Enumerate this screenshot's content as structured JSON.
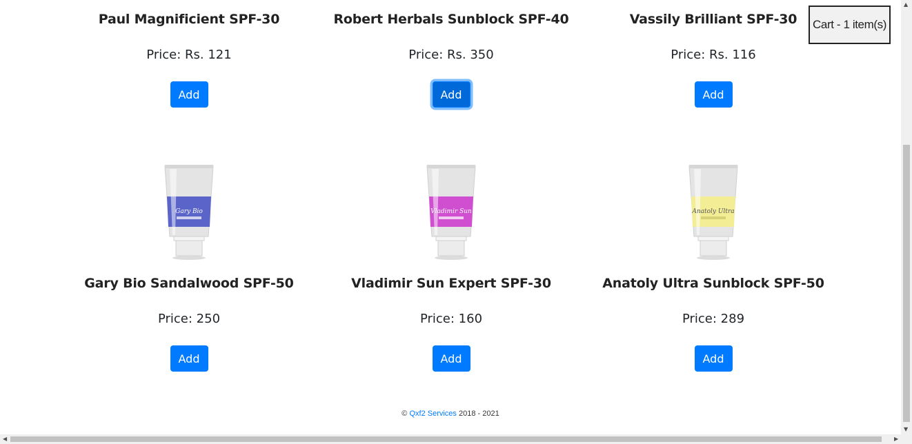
{
  "cart": {
    "label": "Cart - 1 item(s)"
  },
  "products_top": [
    {
      "name": "Paul Magnificient SPF-30",
      "price": "Price: Rs. 121",
      "button": "Add",
      "label_color": "#cfcfcf",
      "label_text": ""
    },
    {
      "name": "Robert Herbals Sunblock SPF-40",
      "price": "Price: Rs. 350",
      "button": "Add",
      "label_color": "#cfcfcf",
      "label_text": ""
    },
    {
      "name": "Vassily Brilliant SPF-30",
      "price": "Price: Rs. 116",
      "button": "Add",
      "label_color": "#cfcfcf",
      "label_text": ""
    }
  ],
  "products_bottom": [
    {
      "name": "Gary Bio Sandalwood SPF-50",
      "price": "Price: 250",
      "button": "Add",
      "label_color": "#5b64c9",
      "label_text": "Gary Bio"
    },
    {
      "name": "Vladimir Sun Expert SPF-30",
      "price": "Price: 160",
      "button": "Add",
      "label_color": "#cf4fd0",
      "label_text": "Vladimir Sun"
    },
    {
      "name": "Anatoly Ultra Sunblock SPF-50",
      "price": "Price: 289",
      "button": "Add",
      "label_color": "#f3ee96",
      "label_text": "Anatoly Ultra"
    }
  ],
  "footer": {
    "copyright": "©",
    "link": "Qxf2 Services",
    "years": "2018 - 2021"
  }
}
